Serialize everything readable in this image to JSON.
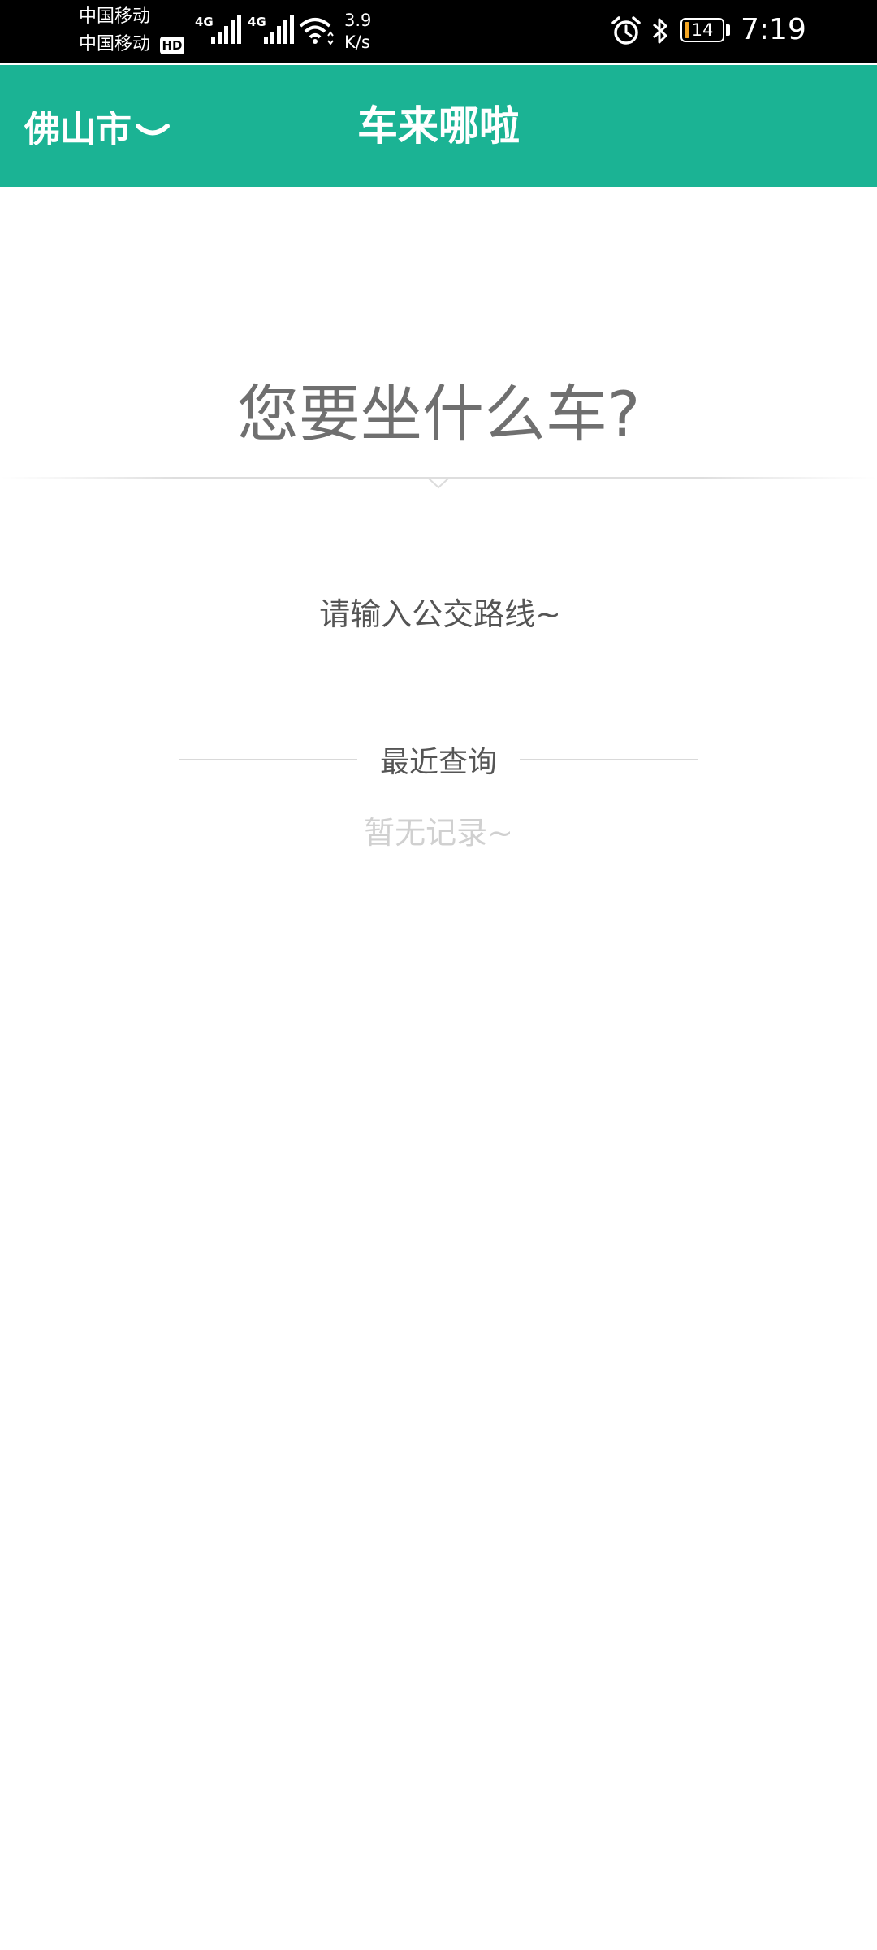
{
  "status_bar": {
    "carrier1": "中国移动",
    "carrier2": "中国移动",
    "hd_badge": "HD",
    "network_type_1": "4G",
    "network_type_2": "4G",
    "net_speed_value": "3.9",
    "net_speed_unit": "K/s",
    "battery_level": "14",
    "battery_percent": 14,
    "time": "7:19",
    "icons": [
      "signal-icon",
      "wifi-icon",
      "alarm-icon",
      "bluetooth-icon",
      "battery-icon"
    ]
  },
  "header": {
    "city": "佛山市",
    "title": "车来哪啦",
    "bg_color": "#1bb394"
  },
  "main": {
    "question": "您要坐什么车?",
    "route_input": {
      "value": "",
      "placeholder": "请输入公交路线~"
    },
    "recent": {
      "title": "最近查询",
      "empty_text": "暂无记录~"
    }
  }
}
